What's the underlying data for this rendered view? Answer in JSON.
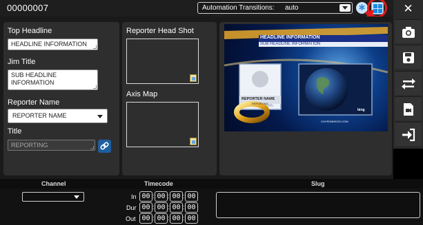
{
  "header": {
    "id": "00000007",
    "automation_label": "Automation Transitions:",
    "automation_value": "auto"
  },
  "form": {
    "top_headline": {
      "label": "Top Headline",
      "value": "HEADLINE INFORMATION"
    },
    "jim_title": {
      "label": "Jim Title",
      "value": "SUB HEADLINE INFORMATION"
    },
    "reporter_name": {
      "label": "Reporter Name",
      "value": "REPORTER NAME"
    },
    "title": {
      "label": "Title",
      "value": "REPORTING"
    }
  },
  "media": {
    "head_shot_label": "Reporter Head Shot",
    "axis_map_label": "Axis Map"
  },
  "preview": {
    "headline": "HEADLINE INFORMATION",
    "subheadline": "SUB HEADLINE INFORMATION",
    "reporter": "REPORTER NAME",
    "reporting": "REPORTING",
    "watermark": "bing",
    "credit": "CHYRONHEGO.COM"
  },
  "bottom": {
    "channel_label": "Channel",
    "timecode_label": "Timecode",
    "slug_label": "Slug",
    "rows": [
      {
        "label": "In",
        "values": [
          "00",
          "00",
          "00",
          "00"
        ]
      },
      {
        "label": "Dur",
        "values": [
          "00",
          "00",
          "00",
          "00"
        ]
      },
      {
        "label": "Out",
        "values": [
          "00",
          "00",
          "00",
          "00"
        ]
      }
    ]
  },
  "sidebar_icons": [
    "close-icon",
    "camera-icon",
    "save-icon",
    "swap-icon",
    "video-file-icon",
    "sign-in-icon"
  ],
  "colors": {
    "accent_blue": "#1f5f9f",
    "highlight_red": "#e31b1b"
  }
}
